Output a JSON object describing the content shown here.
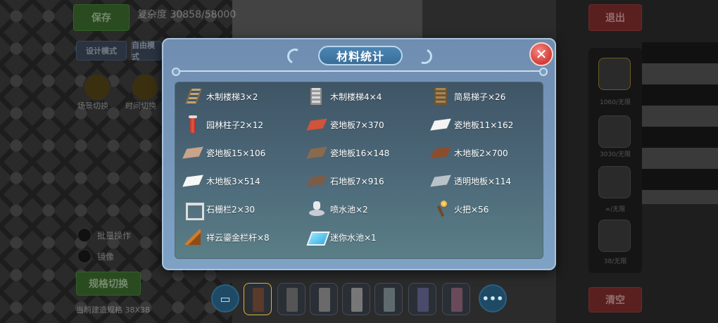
{
  "background": {
    "top_left_button": "保存",
    "progress_text": "复杂度 30858/58000",
    "top_right_button": "退出",
    "mode_buttons": [
      "设计模式",
      "自由模式"
    ],
    "circle_labels": [
      "场景切换",
      "时间切换"
    ],
    "toggle_labels": [
      "批量操作",
      "镜像"
    ],
    "spec_button": "规格切换",
    "build_size_text": "当前建造规格 38X38",
    "right_slot_labels": [
      "1060/无限",
      "3030/无限",
      "∞/无限",
      "38/无限"
    ],
    "bottom_right_button": "清空"
  },
  "dialog": {
    "title": "材料统计",
    "close_symbol": "✕",
    "items": [
      {
        "label": "木制楼梯3×2",
        "icon": "wooden-stairs-icon"
      },
      {
        "label": "木制楼梯4×4",
        "icon": "wooden-ladder-icon"
      },
      {
        "label": "简易梯子×26",
        "icon": "simple-ladder-icon"
      },
      {
        "label": "园林柱子2×12",
        "icon": "garden-pillar-icon"
      },
      {
        "label": "瓷地板7×370",
        "icon": "red-tile-icon",
        "color": "#d0533a"
      },
      {
        "label": "瓷地板11×162",
        "icon": "white-tile-icon",
        "color": "#f4f4f4"
      },
      {
        "label": "瓷地板15×106",
        "icon": "patterned-tile-icon",
        "color": "#c9a48a"
      },
      {
        "label": "瓷地板16×148",
        "icon": "patterned-dark-tile-icon",
        "color": "#8a6a4c"
      },
      {
        "label": "木地板2×700",
        "icon": "brown-wood-floor-icon",
        "color": "#8a4e2e"
      },
      {
        "label": "木地板3×514",
        "icon": "white-wood-floor-icon",
        "color": "#f7f7f7"
      },
      {
        "label": "石地板7×916",
        "icon": "stone-floor-icon",
        "color": "#7a5c4a"
      },
      {
        "label": "透明地板×114",
        "icon": "transparent-floor-icon",
        "color": "#b9c2c8"
      },
      {
        "label": "石栅栏2×30",
        "icon": "stone-fence-icon"
      },
      {
        "label": "喷水池×2",
        "icon": "fountain-icon"
      },
      {
        "label": "火把×56",
        "icon": "torch-icon"
      },
      {
        "label": "祥云鎏金栏杆×8",
        "icon": "golden-railing-icon"
      },
      {
        "label": "迷你水池×1",
        "icon": "mini-pool-icon"
      }
    ]
  },
  "toolbar": {
    "more_symbol": "•••"
  }
}
